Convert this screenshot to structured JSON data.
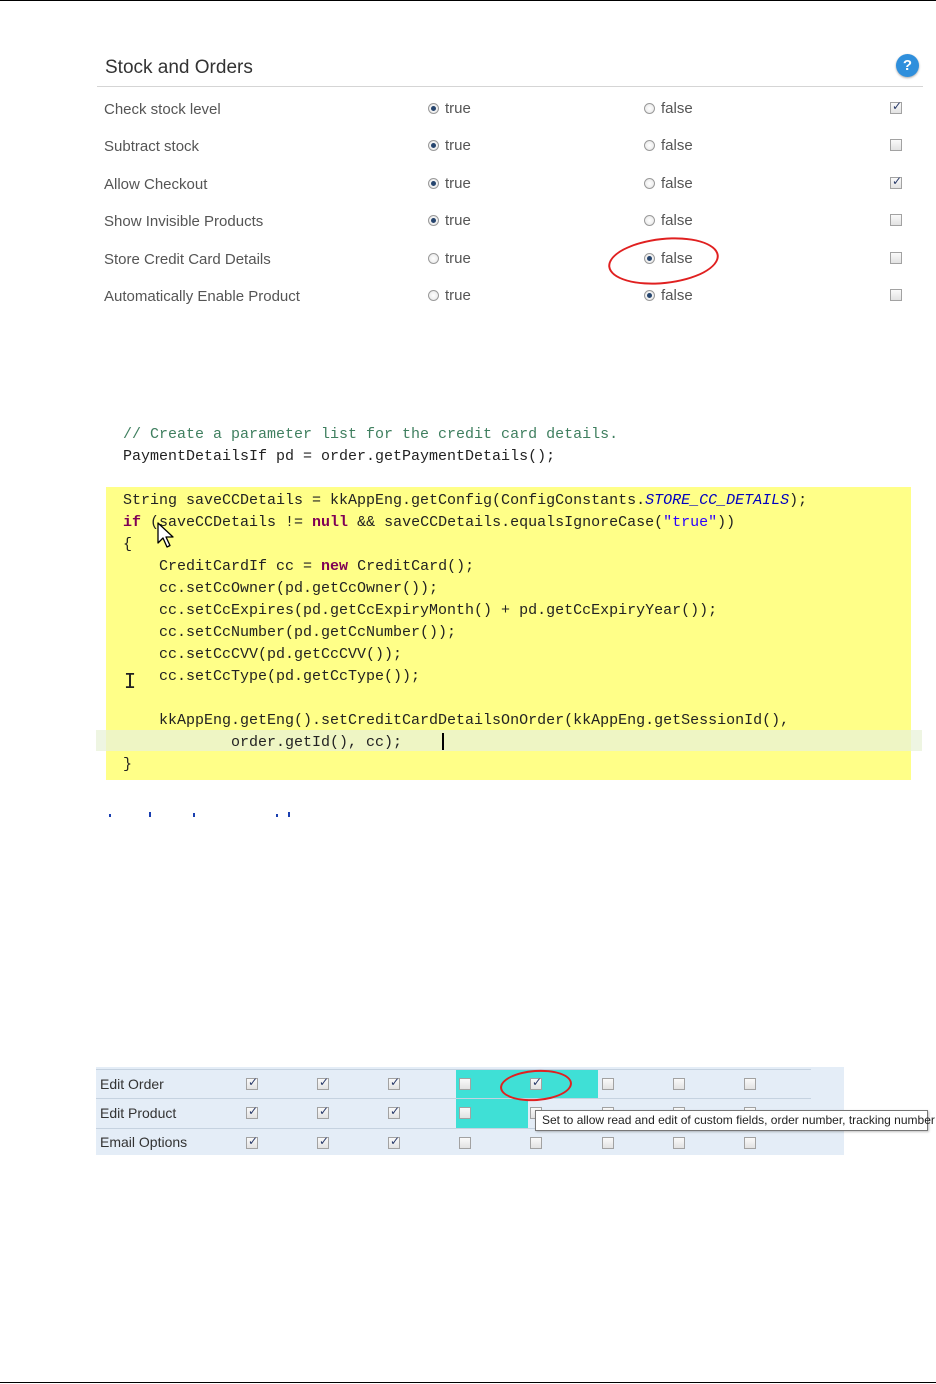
{
  "stock_panel": {
    "title": "Stock and Orders",
    "help_icon": "question-mark-icon",
    "rows": [
      {
        "label": "Check stock level",
        "true_label": "true",
        "false_label": "false",
        "selected": "true",
        "checkbox_checked": true
      },
      {
        "label": "Subtract stock",
        "true_label": "true",
        "false_label": "false",
        "selected": "true",
        "checkbox_checked": false
      },
      {
        "label": "Allow Checkout",
        "true_label": "true",
        "false_label": "false",
        "selected": "true",
        "checkbox_checked": true
      },
      {
        "label": "Show Invisible Products",
        "true_label": "true",
        "false_label": "false",
        "selected": "true",
        "checkbox_checked": false
      },
      {
        "label": "Store Credit Card Details",
        "true_label": "true",
        "false_label": "false",
        "selected": "false",
        "checkbox_checked": false
      },
      {
        "label": "Automatically Enable Product",
        "true_label": "true",
        "false_label": "false",
        "selected": "false",
        "checkbox_checked": false
      }
    ],
    "highlight_color": "#e02020"
  },
  "code": {
    "comment": "// Create a parameter list for the credit card details.",
    "l1": "PaymentDetailsIf pd = order.getPaymentDetails();",
    "l2a": "String saveCCDetails = kkAppEng.getConfig(ConfigConstants.",
    "l2b": "STORE_CC_DETAILS",
    "l2c": ");",
    "l3a": "if",
    "l3b": " (saveCCDetails != ",
    "l3c": "null",
    "l3d": " && saveCCDetails.equalsIgnoreCase(",
    "l3e": "\"true\"",
    "l3f": "))",
    "l4": "{",
    "l5a": "    CreditCardIf cc = ",
    "l5b": "new",
    "l5c": " CreditCard();",
    "l6": "    cc.setCcOwner(pd.getCcOwner());",
    "l7": "    cc.setCcExpires(pd.getCcExpiryMonth() + pd.getCcExpiryYear());",
    "l8": "    cc.setCcNumber(pd.getCcNumber());",
    "l9": "    cc.setCcCVV(pd.getCcCVV());",
    "l10": "    cc.setCcType(pd.getCcType());",
    "l11": "    kkAppEng.getEng().setCreditCardDetailsOnOrder(kkAppEng.getSessionId(),",
    "l12": "            order.getId(), cc);",
    "l13": "}",
    "highlight_color": "#ffff88"
  },
  "permissions": {
    "rows": [
      {
        "label": "Edit Order",
        "checks": [
          true,
          true,
          true,
          false,
          true,
          false,
          false,
          false
        ]
      },
      {
        "label": "Edit Product",
        "checks": [
          true,
          true,
          true,
          false,
          false,
          false,
          false,
          false
        ]
      },
      {
        "label": "Email Options",
        "checks": [
          true,
          true,
          true,
          false,
          false,
          false,
          false,
          false
        ]
      }
    ],
    "tooltip": "Set to allow read and edit of custom fields, order number, tracking number",
    "cyan_color": "#3fe0d6"
  }
}
